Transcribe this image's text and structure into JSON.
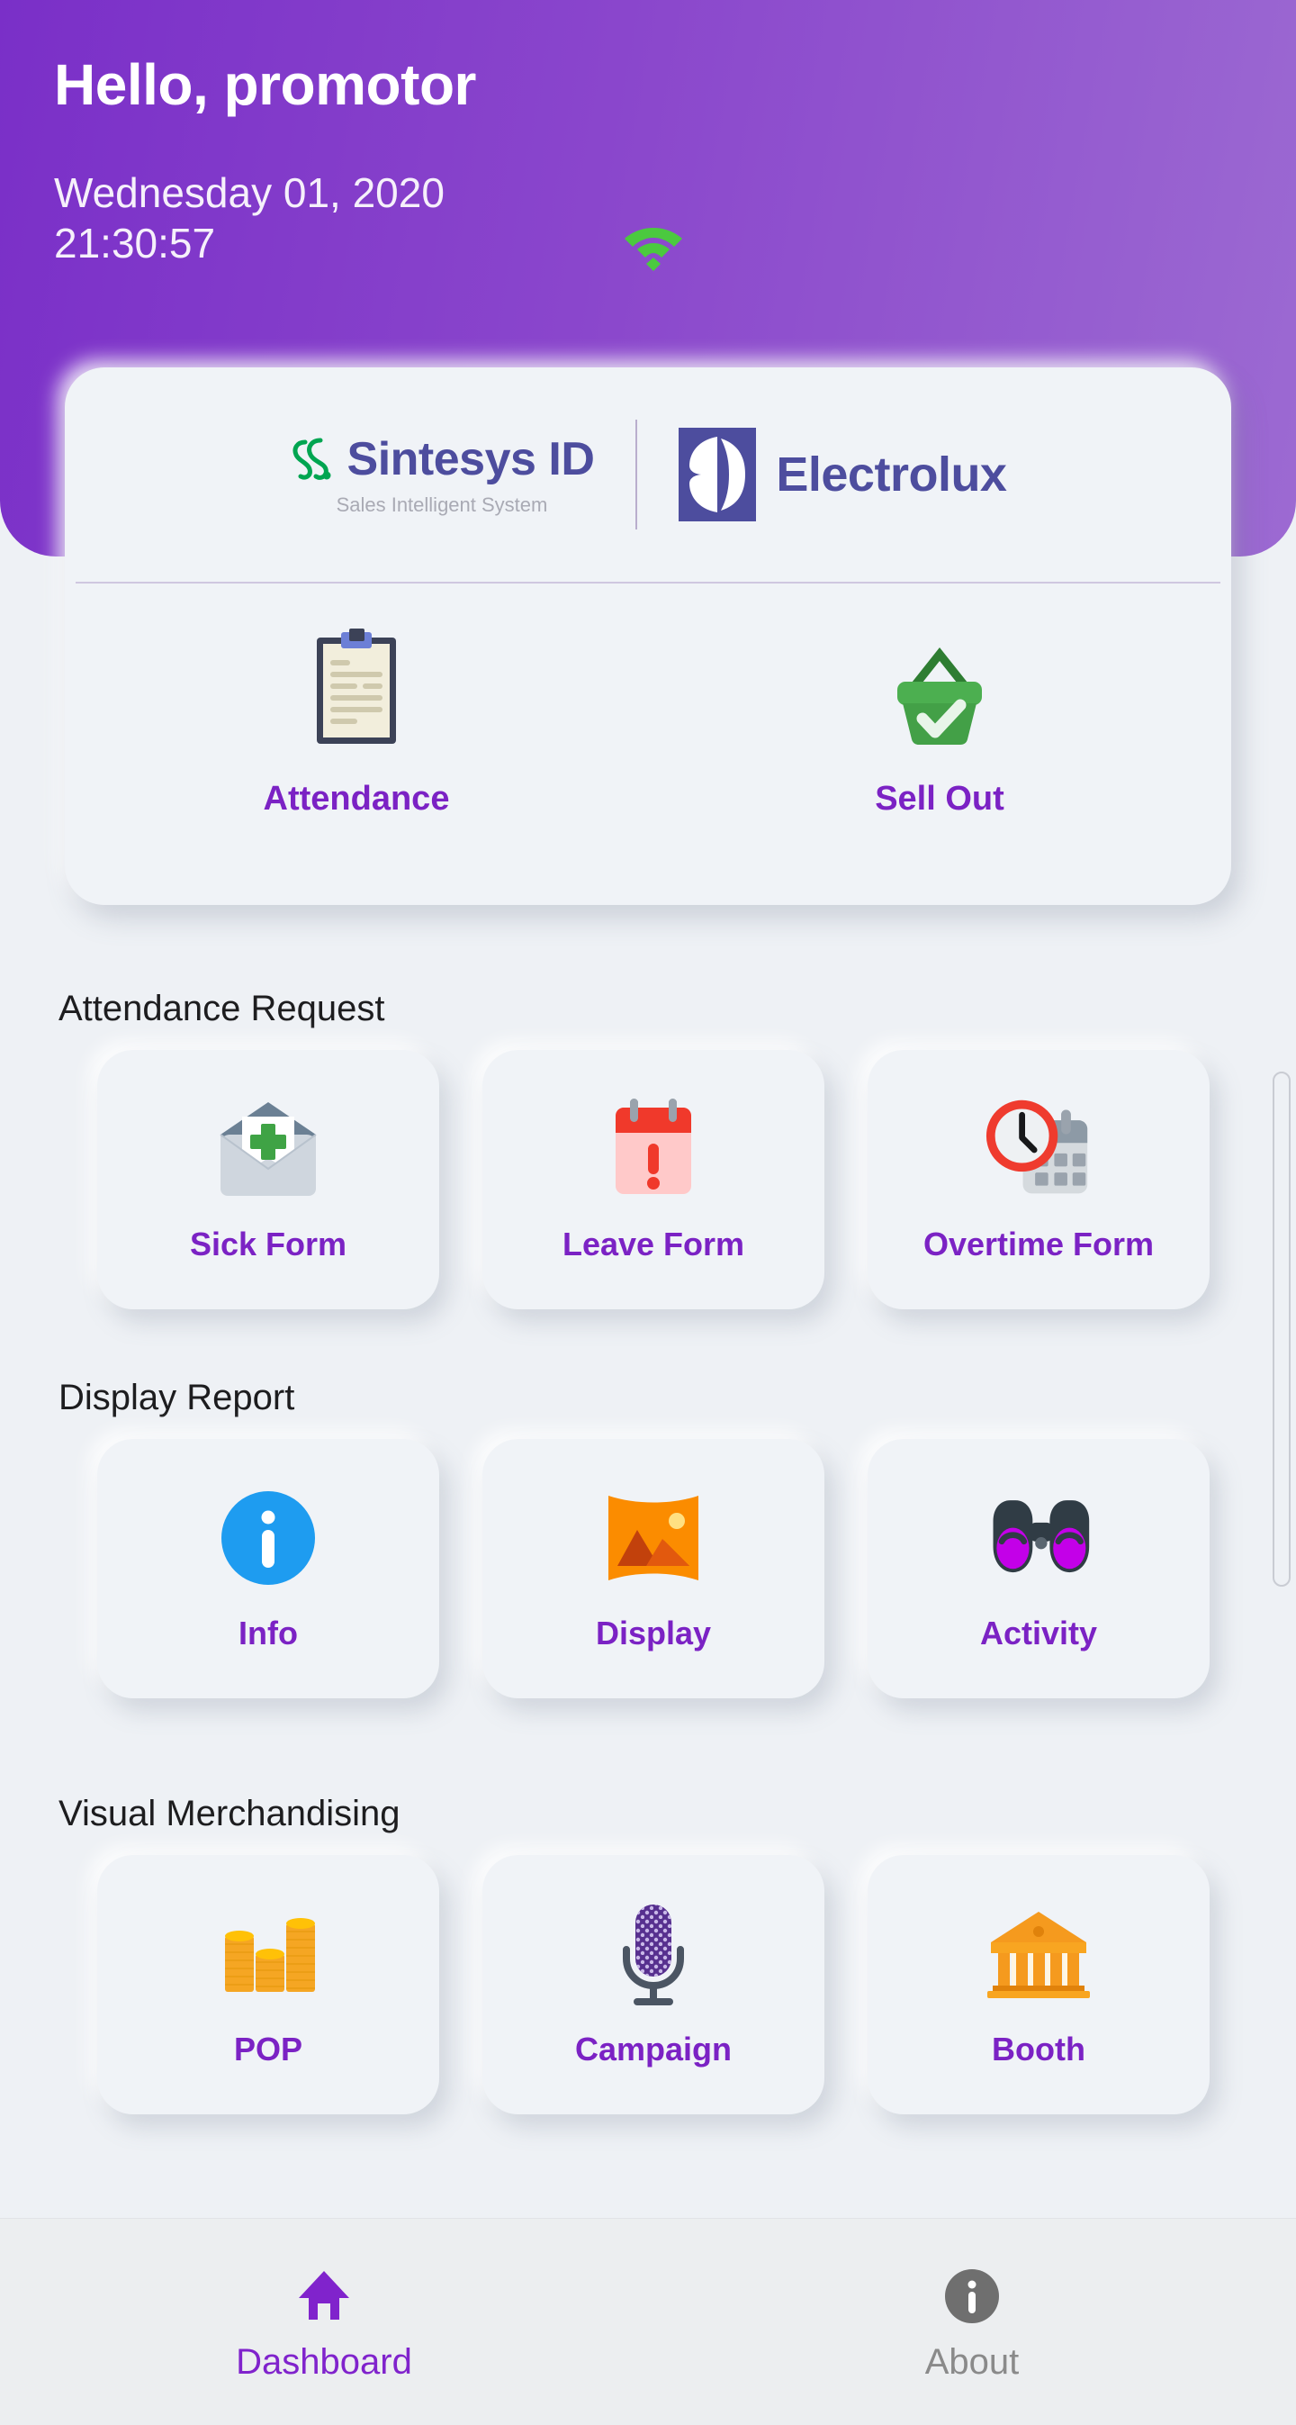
{
  "header": {
    "greeting": "Hello, promotor",
    "date": "Wednesday 01, 2020",
    "time": "21:30:57",
    "wifi_icon": "wifi-icon",
    "wifi_color": "#4bc93f",
    "gradient_from": "#7a2fc8",
    "gradient_to": "#9c6ad2"
  },
  "brand_card": {
    "sintesys": {
      "name": "Sintesys ID",
      "tagline": "Sales Intelligent System",
      "mark_icon": "sintesys-logo-icon",
      "mark_color": "#00a551",
      "text_color": "#4d4d9e"
    },
    "electrolux": {
      "name": "Electrolux",
      "mark_icon": "electrolux-logo-icon",
      "color": "#4d4d9e"
    },
    "shortcuts": [
      {
        "label": "Attendance",
        "icon": "clipboard-icon"
      },
      {
        "label": "Sell Out",
        "icon": "basket-check-icon"
      }
    ]
  },
  "sections": [
    {
      "title": "Attendance Request",
      "tiles": [
        {
          "label": "Sick Form",
          "icon": "envelope-medical-icon"
        },
        {
          "label": "Leave Form",
          "icon": "calendar-alert-icon"
        },
        {
          "label": "Overtime Form",
          "icon": "clock-calendar-icon"
        }
      ]
    },
    {
      "title": "Display Report",
      "tiles": [
        {
          "label": "Info",
          "icon": "info-circle-icon"
        },
        {
          "label": "Display",
          "icon": "picture-icon"
        },
        {
          "label": "Activity",
          "icon": "binoculars-icon"
        }
      ]
    },
    {
      "title": "Visual Merchandising",
      "tiles": [
        {
          "label": "POP",
          "icon": "coins-icon"
        },
        {
          "label": "Campaign",
          "icon": "microphone-icon"
        },
        {
          "label": "Booth",
          "icon": "bank-building-icon"
        }
      ]
    }
  ],
  "bottom_nav": {
    "items": [
      {
        "label": "Dashboard",
        "icon": "home-icon",
        "active": true
      },
      {
        "label": "About",
        "icon": "info-icon",
        "active": false
      }
    ],
    "active_color": "#8023cc",
    "inactive_color": "#8a8a8a"
  },
  "theme": {
    "accent_purple": "#7b22c4",
    "page_background": "#eef1f5",
    "tile_background": "#f0f3f7"
  }
}
